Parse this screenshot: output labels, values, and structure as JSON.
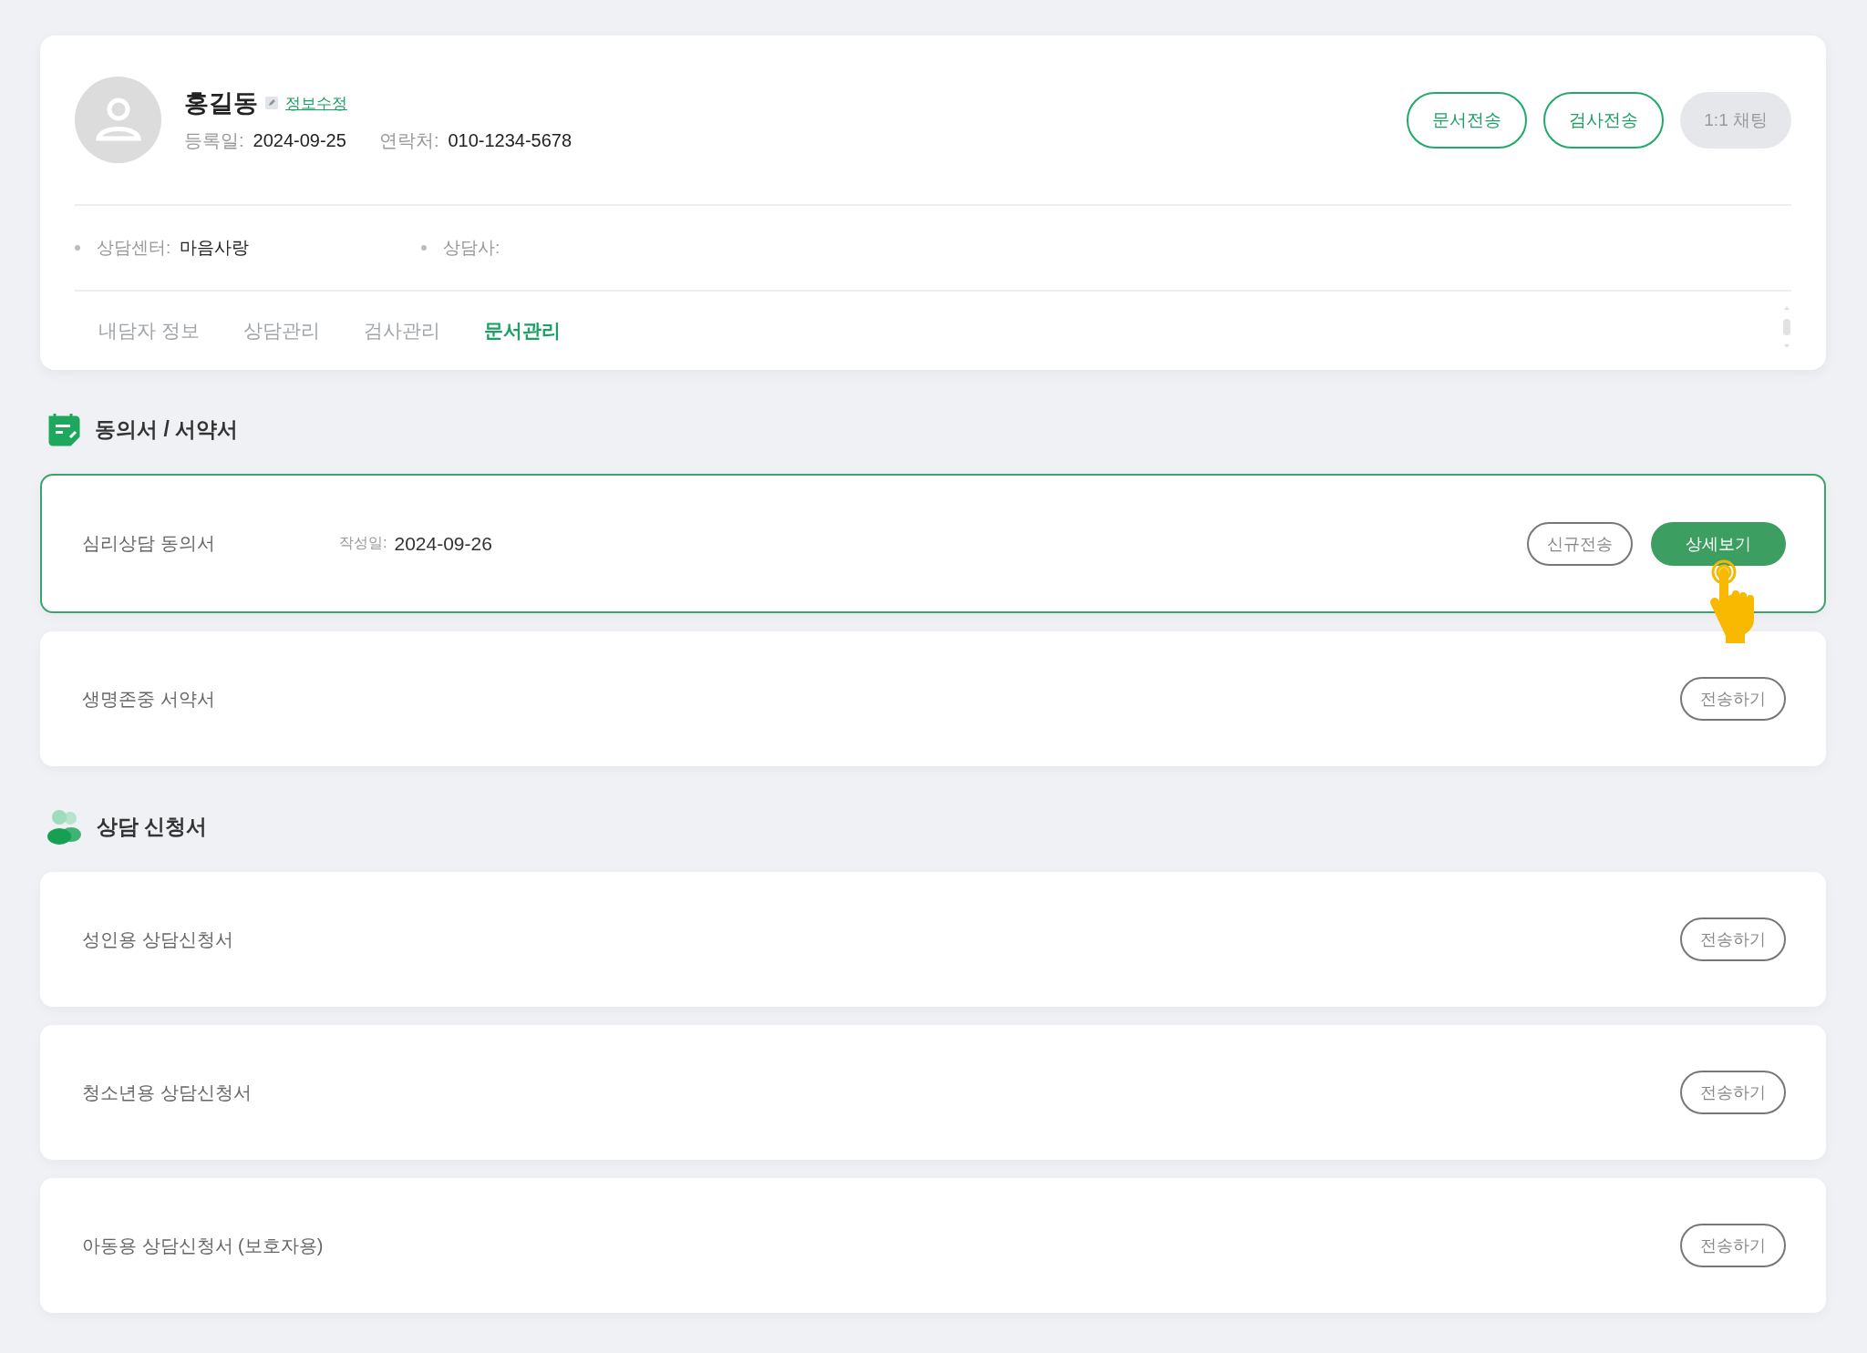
{
  "profile": {
    "name": "홍길동",
    "edit_link": "정보수정",
    "fields": [
      {
        "label": "등록일:",
        "value": "2024-09-25"
      },
      {
        "label": "연락처:",
        "value": "010-1234-5678"
      }
    ],
    "actions": [
      {
        "label": "문서전송",
        "kind": "outline"
      },
      {
        "label": "검사전송",
        "kind": "outline"
      },
      {
        "label": "1:1 채팅",
        "kind": "muted"
      }
    ],
    "info": [
      {
        "label": "상담센터:",
        "value": "마음사랑"
      },
      {
        "label": "상담사:"
      }
    ],
    "tabs": [
      {
        "label": "내담자 정보",
        "selected": false
      },
      {
        "label": "상담관리",
        "selected": false
      },
      {
        "label": "검사관리",
        "selected": false
      },
      {
        "label": "문서관리",
        "selected": true
      }
    ]
  },
  "sections": [
    {
      "title": "동의서 / 서약서",
      "kind": "document",
      "items": [
        {
          "name": "심리상담 동의서",
          "selected": true,
          "date_label": "작성일:",
          "date": "2024-09-26",
          "buttons": [
            {
              "label": "신규전송",
              "kind": "outline"
            },
            {
              "label": "상세보기",
              "kind": "filled"
            }
          ]
        },
        {
          "name": "생명존중 서약서",
          "selected": false,
          "buttons": [
            {
              "label": "전송하기",
              "kind": "outline"
            }
          ]
        }
      ]
    },
    {
      "title": "상담 신청서",
      "kind": "people",
      "items": [
        {
          "name": "성인용 상담신청서",
          "selected": false,
          "buttons": [
            {
              "label": "전송하기",
              "kind": "outline"
            }
          ]
        },
        {
          "name": "청소년용 상담신청서",
          "selected": false,
          "buttons": [
            {
              "label": "전송하기",
              "kind": "outline"
            }
          ]
        },
        {
          "name": "아동용 상담신청서 (보호자용)",
          "selected": false,
          "buttons": [
            {
              "label": "전송하기",
              "kind": "outline"
            }
          ]
        }
      ]
    }
  ]
}
